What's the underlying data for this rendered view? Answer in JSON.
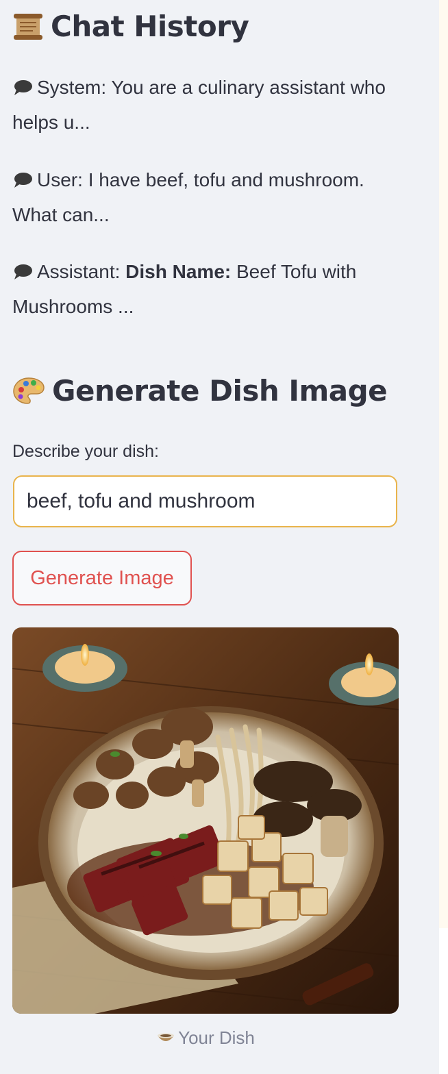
{
  "chat_history": {
    "title": "Chat History",
    "title_icon": "scroll-icon",
    "messages": [
      {
        "role": "System",
        "prefix": "System: ",
        "bold": "",
        "text": "You are a culinary assistant who helps u..."
      },
      {
        "role": "User",
        "prefix": "User: ",
        "bold": "",
        "text": "I have beef, tofu and mushroom. What can..."
      },
      {
        "role": "Assistant",
        "prefix": "Assistant: ",
        "bold": "Dish Name:",
        "text": " Beef Tofu with Mushrooms ..."
      }
    ]
  },
  "generator": {
    "title": "Generate Dish Image",
    "title_icon": "palette-icon",
    "input_label": "Describe your dish:",
    "input_value": "beef, tofu and mushroom",
    "button_label": "Generate Image",
    "caption": "Your Dish",
    "caption_icon": "bowl-icon"
  },
  "colors": {
    "sidebar_bg": "#f0f2f6",
    "text": "#31333f",
    "input_border": "#e9b44c",
    "button_accent": "#e0514f",
    "caption": "#808495"
  }
}
